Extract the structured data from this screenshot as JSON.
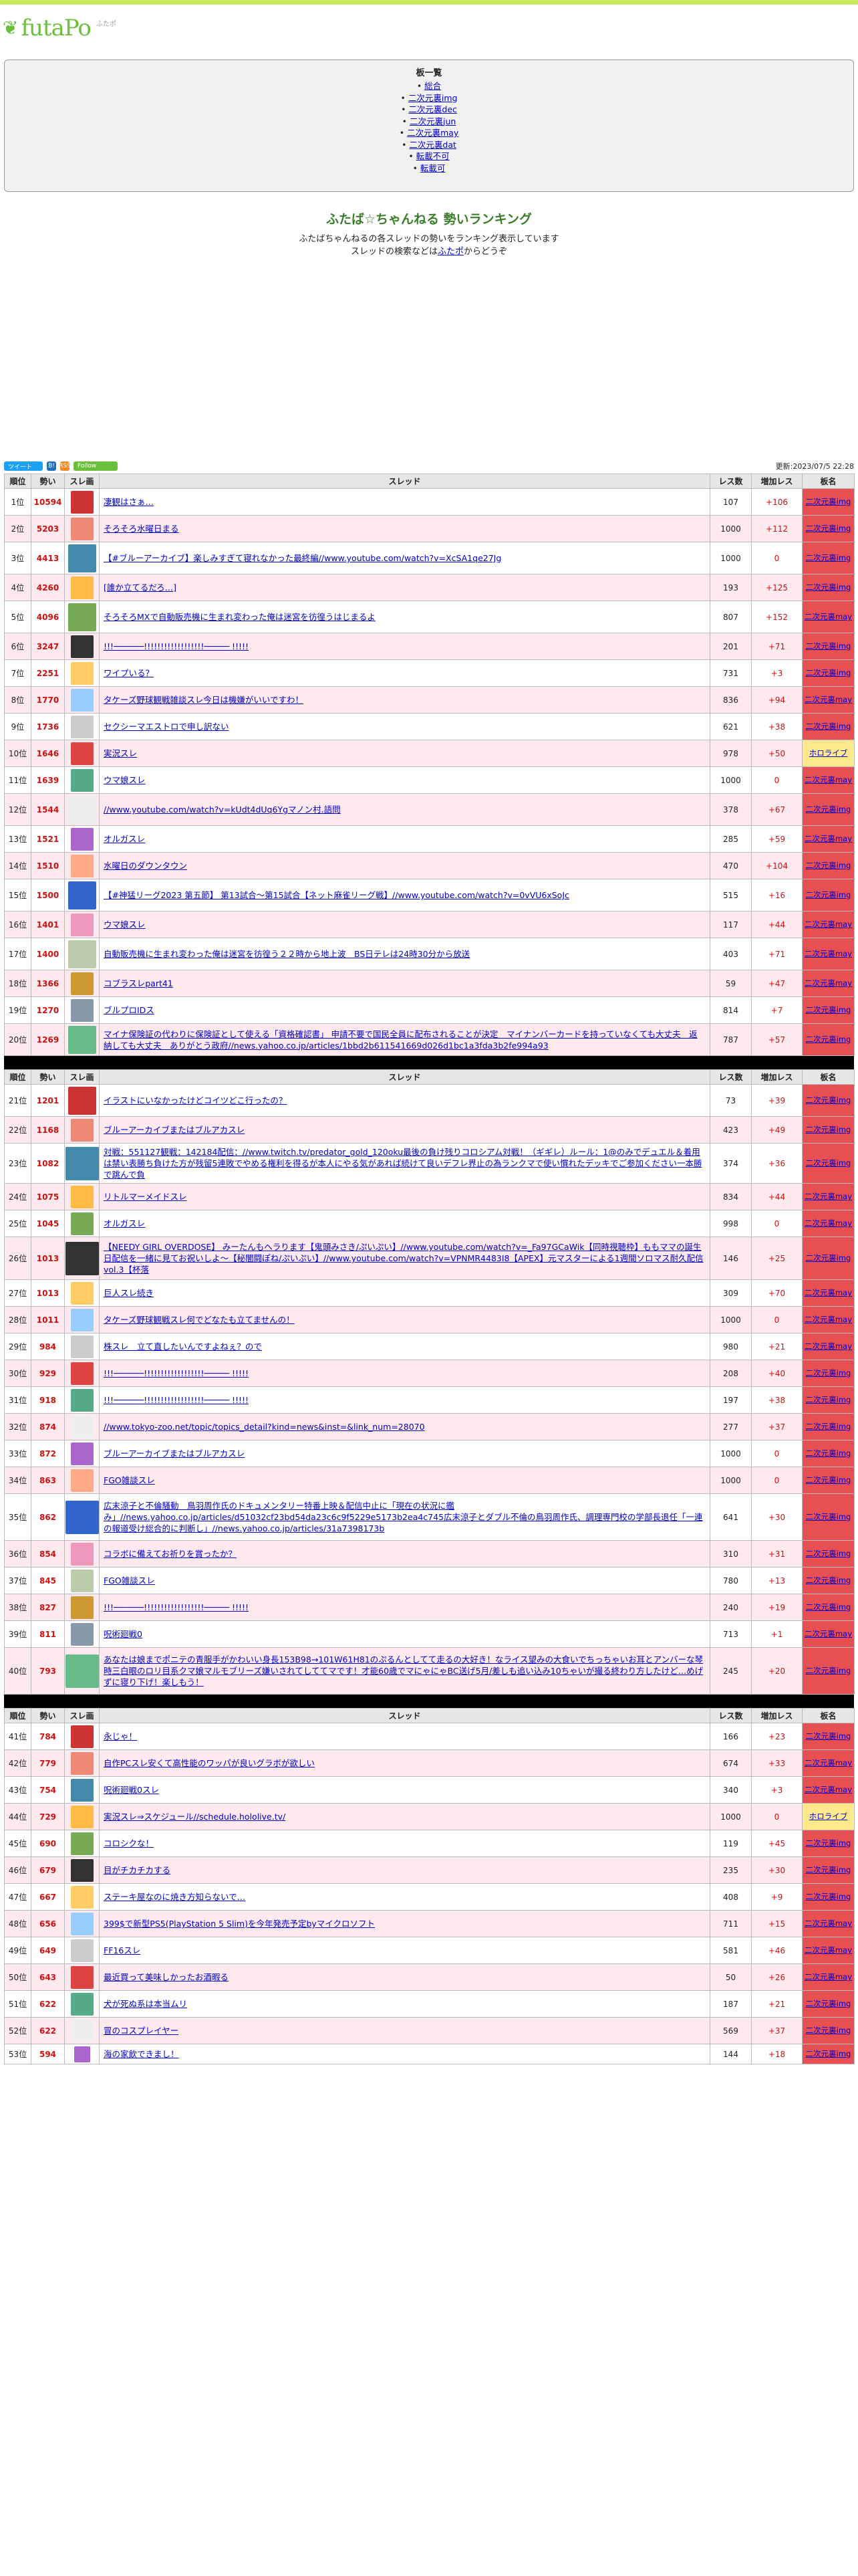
{
  "logo": {
    "name": "futaPo",
    "sub": "ふたポ"
  },
  "menu": {
    "title": "板一覧",
    "items": [
      "総合",
      "二次元裏img",
      "二次元裏dec",
      "二次元裏jun",
      "二次元裏may",
      "二次元裏dat",
      "転載不可",
      "転載可"
    ]
  },
  "intro": {
    "title": "ふたば☆ちゃんねる 勢いランキング",
    "line1": "ふたばちゃんねるの各スレッドの勢いをランキング表示しています",
    "line2_prefix": "スレッドの検索などは",
    "line2_link": "ふたポ",
    "line2_suffix": "からどうぞ"
  },
  "social": {
    "tweet": "ツイート",
    "hatena": "B!",
    "rss": "RSS",
    "follow": "Follow",
    "updated": "更新:2023/07/5 22:28"
  },
  "headers": {
    "rank": "順位",
    "momentum": "勢い",
    "thumb": "スレ画",
    "thread": "スレッド",
    "res": "レス数",
    "inc": "増加レス",
    "board": "板名"
  },
  "colors": {
    "red_board": "#e84f53",
    "yellow_board": "#ffe98c",
    "row_alt": "#fde9ee",
    "accent_green": "#6cbf3c"
  },
  "rows": [
    {
      "rank": "1位",
      "ik": "10594",
      "title": "凄観はさぁ…",
      "res": "107",
      "inc": "+106",
      "board": "二次元裏img",
      "bc": "red"
    },
    {
      "rank": "2位",
      "ik": "5203",
      "title": "そろそろ水曜日まる",
      "res": "1000",
      "inc": "+112",
      "board": "二次元裏img",
      "bc": "red"
    },
    {
      "rank": "3位",
      "ik": "4413",
      "title": "【#ブルーアーカイブ】楽しみすぎて寝れなかった最終編//www.youtube.com/watch?v=XcSA1qe27Jg",
      "res": "1000",
      "inc": "0",
      "board": "二次元裏img",
      "bc": "red"
    },
    {
      "rank": "4位",
      "ik": "4260",
      "title": "[誰か立てるだろ…]",
      "res": "193",
      "inc": "+125",
      "board": "二次元裏img",
      "bc": "red"
    },
    {
      "rank": "5位",
      "ik": "4096",
      "title": "そろそろMXで自動販売機に生まれ変わった俺は迷宮を彷徨うはじまるよ",
      "res": "807",
      "inc": "+152",
      "board": "二次元裏may",
      "bc": "red"
    },
    {
      "rank": "6位",
      "ik": "3247",
      "title": "!!!──────!!!!!!!!!!!!!!!!!!───── !!!!!",
      "res": "201",
      "inc": "+71",
      "board": "二次元裏img",
      "bc": "red"
    },
    {
      "rank": "7位",
      "ik": "2251",
      "title": "ワイプいる？",
      "res": "731",
      "inc": "+3",
      "board": "二次元裏img",
      "bc": "red"
    },
    {
      "rank": "8位",
      "ik": "1770",
      "title": "タケーズ野球観戦雑談スレ今日は機嫌がいいですわ！",
      "res": "836",
      "inc": "+94",
      "board": "二次元裏may",
      "bc": "red"
    },
    {
      "rank": "9位",
      "ik": "1736",
      "title": "セクシーマエストロで申し訳ない",
      "res": "621",
      "inc": "+38",
      "board": "二次元裏img",
      "bc": "red"
    },
    {
      "rank": "10位",
      "ik": "1646",
      "title": "実況スレ",
      "res": "978",
      "inc": "+50",
      "board": "ホロライブ",
      "bc": "yel"
    },
    {
      "rank": "11位",
      "ik": "1639",
      "title": "ウマ娘スレ",
      "res": "1000",
      "inc": "0",
      "board": "二次元裏may",
      "bc": "red"
    },
    {
      "rank": "12位",
      "ik": "1544",
      "title": "//www.youtube.com/watch?v=kUdt4dUq6Ygマノン村.語問",
      "res": "378",
      "inc": "+67",
      "board": "二次元裏img",
      "bc": "red"
    },
    {
      "rank": "13位",
      "ik": "1521",
      "title": "オルガスレ",
      "res": "285",
      "inc": "+59",
      "board": "二次元裏may",
      "bc": "red"
    },
    {
      "rank": "14位",
      "ik": "1510",
      "title": "水曜日のダウンタウン",
      "res": "470",
      "inc": "+104",
      "board": "二次元裏img",
      "bc": "red"
    },
    {
      "rank": "15位",
      "ik": "1500",
      "title": "【#神猛リーグ2023 第五節】 第13試合〜第15試合【ネット麻雀リーグ戦】//www.youtube.com/watch?v=0vVU6xSoJc",
      "res": "515",
      "inc": "+16",
      "board": "二次元裏img",
      "bc": "red"
    },
    {
      "rank": "16位",
      "ik": "1401",
      "title": "ウマ娘スレ",
      "res": "117",
      "inc": "+44",
      "board": "二次元裏may",
      "bc": "red"
    },
    {
      "rank": "17位",
      "ik": "1400",
      "title": "自動販売機に生まれ変わった俺は迷宮を彷徨う２２時から地上波　BS日テレは24時30分から放送",
      "res": "403",
      "inc": "+71",
      "board": "二次元裏may",
      "bc": "red"
    },
    {
      "rank": "18位",
      "ik": "1366",
      "title": "コブラスレpart41",
      "res": "59",
      "inc": "+47",
      "board": "二次元裏may",
      "bc": "red"
    },
    {
      "rank": "19位",
      "ik": "1270",
      "title": "ブルプロIDス",
      "res": "814",
      "inc": "+7",
      "board": "二次元裏img",
      "bc": "red"
    },
    {
      "rank": "20位",
      "ik": "1269",
      "title": "マイナ保険証の代わりに保険証として使える「資格確認書」 申請不要で国民全員に配布されることが決定　マイナンバーカードを持っていなくても大丈夫　返納しても大丈夫　ありがとう政府//news.yahoo.co.jp/articles/1bbd2b611541669d026d1bc1a3fda3b2fe994a93",
      "res": "787",
      "inc": "+57",
      "board": "二次元裏img",
      "bc": "red"
    },
    {
      "rank": "21位",
      "ik": "1201",
      "title": "イラストにいなかったけどコイツどこ行ったの？",
      "res": "73",
      "inc": "+39",
      "board": "二次元裏img",
      "bc": "red"
    },
    {
      "rank": "22位",
      "ik": "1168",
      "title": "ブルーアーカイブまたはブルアカスレ",
      "res": "423",
      "inc": "+49",
      "board": "二次元裏img",
      "bc": "red"
    },
    {
      "rank": "23位",
      "ik": "1082",
      "title": "対戦：551127観戦：142184配信：//www.twitch.tv/predator_gold_120oku最後の負け残りコロシアム対戦！（ギギレ）ルール：1@のみでデュエル＆着用は禁い表勝ち負けた方が残留5連敗でやめる権利を得るが本人にやる気があれば続けて良いデフレ界止の為ランクマで使い慣れたデッキでご参加ください一本勝で跳んで負",
      "res": "374",
      "inc": "+36",
      "board": "二次元裏img",
      "bc": "red"
    },
    {
      "rank": "24位",
      "ik": "1075",
      "title": "リトルマーメイドスレ",
      "res": "834",
      "inc": "+44",
      "board": "二次元裏may",
      "bc": "red"
    },
    {
      "rank": "25位",
      "ik": "1045",
      "title": "オルガスレ",
      "res": "998",
      "inc": "0",
      "board": "二次元裏may",
      "bc": "red"
    },
    {
      "rank": "26位",
      "ik": "1013",
      "title": "【NEEDY GIRL OVERDOSE】 みーたんもへラります【鬼頭みさき/ぷいぷい】//www.youtube.com/watch?v=_Fa97GCaWik【同時視聴枠】ももママの誕生日配信を一緒に見てお祝いしよ〜【秘闇闘ぽね/ぷいぷい】//www.youtube.com/watch?v=VPNMR4483I8【APEX】元マスターによる1週間ソロマス耐久配信 vol.3【杯落",
      "res": "146",
      "inc": "+25",
      "board": "二次元裏img",
      "bc": "red"
    },
    {
      "rank": "27位",
      "ik": "1013",
      "title": "巨人スレ続き",
      "res": "309",
      "inc": "+70",
      "board": "二次元裏may",
      "bc": "red"
    },
    {
      "rank": "28位",
      "ik": "1011",
      "title": "タケーズ野球観戦スレ何でどなたも立てませんの！",
      "res": "1000",
      "inc": "0",
      "board": "二次元裏may",
      "bc": "red"
    },
    {
      "rank": "29位",
      "ik": "984",
      "title": "株スレ　立て直したいんですよねぇ？ので",
      "res": "980",
      "inc": "+21",
      "board": "二次元裏may",
      "bc": "red"
    },
    {
      "rank": "30位",
      "ik": "929",
      "title": "!!!──────!!!!!!!!!!!!!!!!!!───── !!!!!",
      "res": "208",
      "inc": "+40",
      "board": "二次元裏img",
      "bc": "red"
    },
    {
      "rank": "31位",
      "ik": "918",
      "title": "!!!──────!!!!!!!!!!!!!!!!!!───── !!!!!",
      "res": "197",
      "inc": "+38",
      "board": "二次元裏img",
      "bc": "red"
    },
    {
      "rank": "32位",
      "ik": "874",
      "title": "//www.tokyo-zoo.net/topic/topics_detail?kind=news&inst=&link_num=28070",
      "res": "277",
      "inc": "+37",
      "board": "二次元裏img",
      "bc": "red"
    },
    {
      "rank": "33位",
      "ik": "872",
      "title": "ブルーアーカイブまたはブルアカスレ",
      "res": "1000",
      "inc": "0",
      "board": "二次元裏img",
      "bc": "red"
    },
    {
      "rank": "34位",
      "ik": "863",
      "title": "FGO雑談スレ",
      "res": "1000",
      "inc": "0",
      "board": "二次元裏img",
      "bc": "red"
    },
    {
      "rank": "35位",
      "ik": "862",
      "title": "広末涼子と不倫騒動　鳥羽周作氏のドキュメンタリー特番上映＆配信中止に「現在の状況に鑑み」//news.yahoo.co.jp/articles/d51032cf23bd54da23c6c9f5229e5173b2ea4c745広末涼子とダブル不倫の鳥羽周作氏、調理専門校の学部長退任「一連の報道受け総合的に判断し」//news.yahoo.co.jp/articles/31a7398173b",
      "res": "641",
      "inc": "+30",
      "board": "二次元裏img",
      "bc": "red"
    },
    {
      "rank": "36位",
      "ik": "854",
      "title": "コラボに備えてお祈りを賞ったか？",
      "res": "310",
      "inc": "+31",
      "board": "二次元裏img",
      "bc": "red"
    },
    {
      "rank": "37位",
      "ik": "845",
      "title": "FGO雑談スレ",
      "res": "780",
      "inc": "+13",
      "board": "二次元裏img",
      "bc": "red"
    },
    {
      "rank": "38位",
      "ik": "827",
      "title": "!!!──────!!!!!!!!!!!!!!!!!!───── !!!!!",
      "res": "240",
      "inc": "+19",
      "board": "二次元裏img",
      "bc": "red"
    },
    {
      "rank": "39位",
      "ik": "811",
      "title": "呪術廻戦0",
      "res": "713",
      "inc": "+1",
      "board": "二次元裏may",
      "bc": "red"
    },
    {
      "rank": "40位",
      "ik": "793",
      "title": "あなたは娘までポニテの青服手がかわいい身長153B98→101W61H81のぷるんとしてて走るの大好き！なライス望みの大食いでちっちゃいお耳とアンバーな琴時三白眼のロリ目系クマ娘マルモブリーズ嫌いされてしててマです！才能60歳でマにゃにゃBC送げ5月/差しも追い込み10ちゃいが撮る終わり方したけど…めげずに寝り下げ！楽しもう！",
      "res": "245",
      "inc": "+20",
      "board": "二次元裏img",
      "bc": "red"
    },
    {
      "rank": "41位",
      "ik": "784",
      "title": "永じゃ！",
      "res": "166",
      "inc": "+23",
      "board": "二次元裏img",
      "bc": "red"
    },
    {
      "rank": "42位",
      "ik": "779",
      "title": "自作PCスレ安くて高性能のワッパが良いグラボが欲しい",
      "res": "674",
      "inc": "+33",
      "board": "二次元裏may",
      "bc": "red"
    },
    {
      "rank": "43位",
      "ik": "754",
      "title": "呪術廻戦0スレ",
      "res": "340",
      "inc": "+3",
      "board": "二次元裏may",
      "bc": "red"
    },
    {
      "rank": "44位",
      "ik": "729",
      "title": "実況スレ⇒スケジュール//schedule.hololive.tv/",
      "res": "1000",
      "inc": "0",
      "board": "ホロライブ",
      "bc": "yel"
    },
    {
      "rank": "45位",
      "ik": "690",
      "title": "コロシクな！",
      "res": "119",
      "inc": "+45",
      "board": "二次元裏img",
      "bc": "red"
    },
    {
      "rank": "46位",
      "ik": "679",
      "title": "目がチカチカする",
      "res": "235",
      "inc": "+30",
      "board": "二次元裏img",
      "bc": "red"
    },
    {
      "rank": "47位",
      "ik": "667",
      "title": "ステーキ屋なのに焼き方知らないで…",
      "res": "408",
      "inc": "+9",
      "board": "二次元裏img",
      "bc": "red"
    },
    {
      "rank": "48位",
      "ik": "656",
      "title": "399$で新型PS5(PlayStation 5 Slim)を今年発売予定byマイクロソフト",
      "res": "711",
      "inc": "+15",
      "board": "二次元裏may",
      "bc": "red"
    },
    {
      "rank": "49位",
      "ik": "649",
      "title": "FF16スレ",
      "res": "581",
      "inc": "+46",
      "board": "二次元裏may",
      "bc": "red"
    },
    {
      "rank": "50位",
      "ik": "643",
      "title": "最近買って美味しかったお酒暇る",
      "res": "50",
      "inc": "+26",
      "board": "二次元裏may",
      "bc": "red"
    },
    {
      "rank": "51位",
      "ik": "622",
      "title": "犬が死ぬ系は本当ムリ",
      "res": "187",
      "inc": "+21",
      "board": "二次元裏img",
      "bc": "red"
    },
    {
      "rank": "52位",
      "ik": "622",
      "title": "冒のコスプレイヤー",
      "res": "569",
      "inc": "+37",
      "board": "二次元裏img",
      "bc": "red"
    },
    {
      "rank": "53位",
      "ik": "594",
      "title": "海の家飲できまし！",
      "res": "144",
      "inc": "+18",
      "board": "二次元裏img",
      "bc": "red"
    }
  ]
}
